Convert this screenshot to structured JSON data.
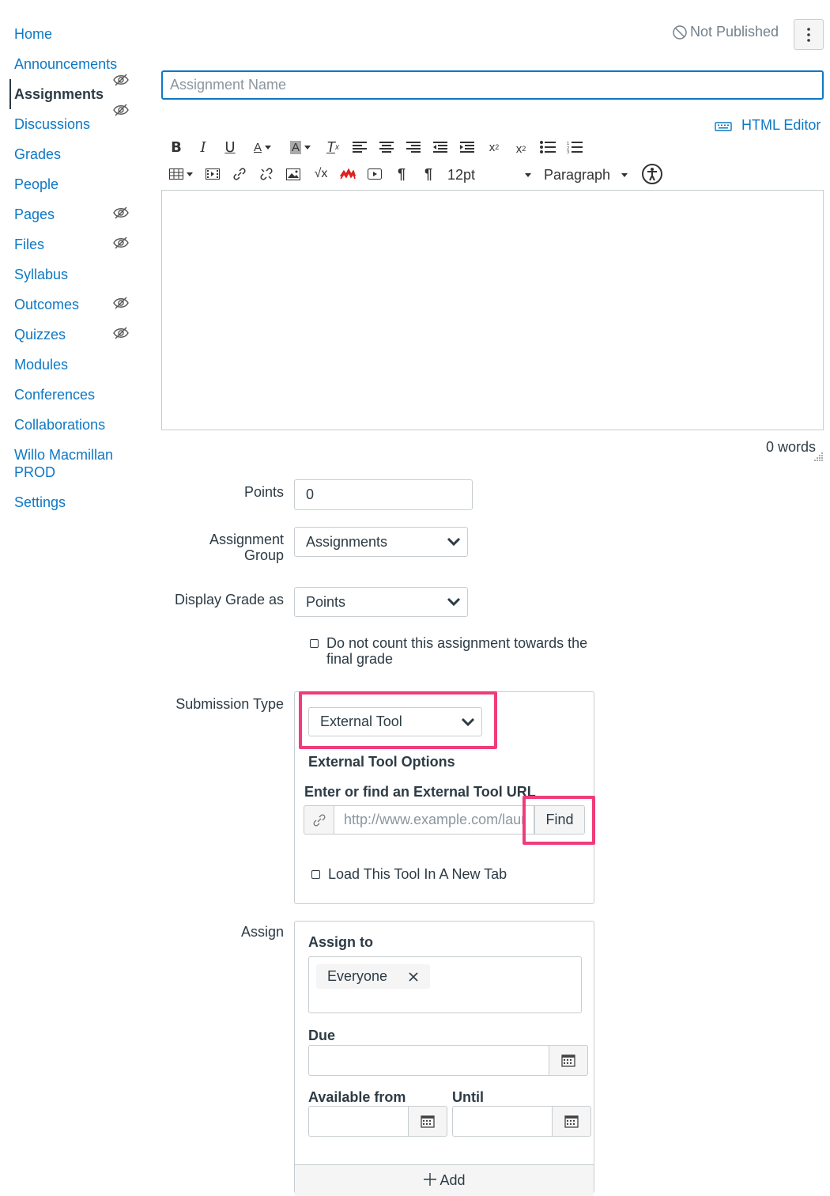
{
  "nav": {
    "items": [
      {
        "label": "Home",
        "hidden": false,
        "active": false
      },
      {
        "label": "Announcements",
        "hidden": true,
        "active": false
      },
      {
        "label": "Assignments",
        "hidden": true,
        "active": true
      },
      {
        "label": "Discussions",
        "hidden": false,
        "active": false
      },
      {
        "label": "Grades",
        "hidden": false,
        "active": false
      },
      {
        "label": "People",
        "hidden": false,
        "active": false
      },
      {
        "label": "Pages",
        "hidden": true,
        "active": false
      },
      {
        "label": "Files",
        "hidden": true,
        "active": false
      },
      {
        "label": "Syllabus",
        "hidden": false,
        "active": false
      },
      {
        "label": "Outcomes",
        "hidden": true,
        "active": false
      },
      {
        "label": "Quizzes",
        "hidden": true,
        "active": false
      },
      {
        "label": "Modules",
        "hidden": false,
        "active": false
      },
      {
        "label": "Conferences",
        "hidden": false,
        "active": false
      },
      {
        "label": "Collaborations",
        "hidden": false,
        "active": false
      },
      {
        "label": "Willo Macmillan",
        "hidden": false,
        "active": false
      },
      {
        "label": "PROD",
        "hidden": false,
        "active": false
      },
      {
        "label": "Settings",
        "hidden": false,
        "active": false
      }
    ]
  },
  "header": {
    "status": "Not Published",
    "status_icon": "ban-icon",
    "menu_icon": "kebab-icon"
  },
  "assignment": {
    "name_placeholder": "Assignment Name",
    "name_value": ""
  },
  "editor": {
    "html_editor_label": "HTML Editor",
    "font_size": "12pt",
    "block_format": "Paragraph",
    "word_count": "0 words"
  },
  "form": {
    "points_label": "Points",
    "points_value": "0",
    "group_label_1": "Assignment",
    "group_label_2": "Group",
    "group_value": "Assignments",
    "display_grade_label": "Display Grade as",
    "display_grade_value": "Points",
    "exclude_label_1": "Do not count this assignment towards the",
    "exclude_label_2": "final grade",
    "submission_type_label": "Submission Type",
    "submission_type_value": "External Tool",
    "external_tool_options": "External Tool Options",
    "external_tool_url_label": "Enter or find an External Tool URL",
    "external_tool_url_placeholder": "http://www.example.com/launch",
    "find_button": "Find",
    "new_tab_label": "Load This Tool In A New Tab"
  },
  "assign": {
    "label": "Assign",
    "assign_to_label": "Assign to",
    "assignee": "Everyone",
    "due_label": "Due",
    "available_from_label": "Available from",
    "until_label": "Until",
    "add_label": "Add"
  },
  "colors": {
    "link": "#0e78c4",
    "text": "#2d3b45",
    "highlight": "#ef3c7a",
    "border": "#c7cdd1"
  }
}
